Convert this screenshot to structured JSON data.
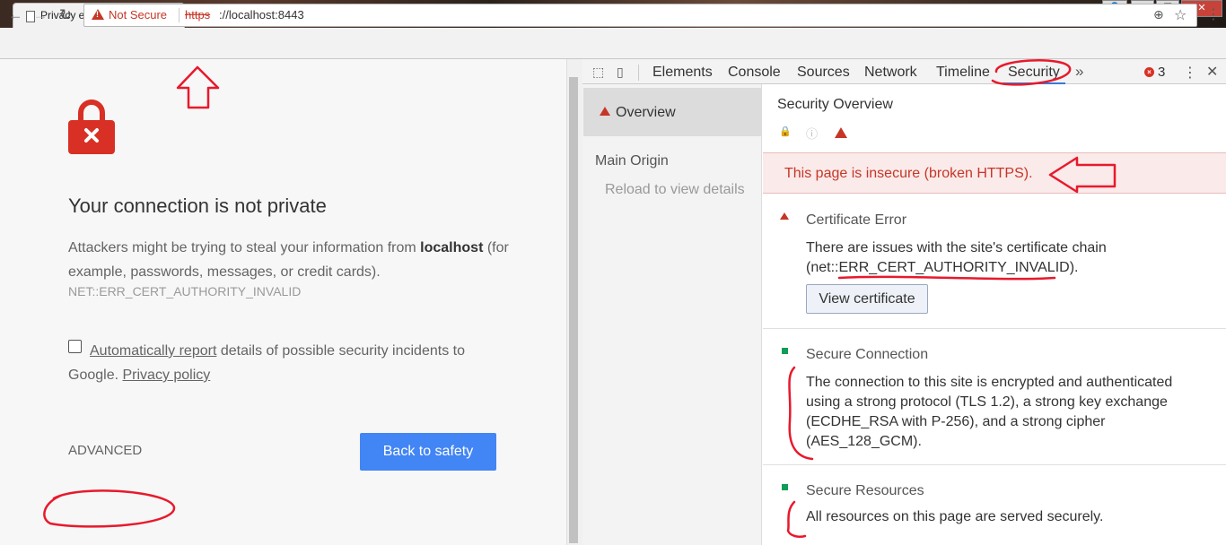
{
  "tab": {
    "title": "Privacy error",
    "close": "×"
  },
  "window": {
    "min": "—",
    "max": "❐",
    "close": "✕",
    "user": "👤"
  },
  "toolbar": {
    "back": "←",
    "forward": "→",
    "reload": "↻",
    "not_secure": "Not Secure",
    "url_scheme": "https",
    "url_rest": "://localhost:8443",
    "zoom_icon": "⊕",
    "star_icon": "☆",
    "menu_icon": "⋮"
  },
  "page": {
    "heading": "Your connection is not private",
    "body_pre": "Attackers might be trying to steal your information from ",
    "body_host": "localhost",
    "body_post": " (for example, passwords, messages, or credit cards).",
    "error_code": "NET::ERR_CERT_AUTHORITY_INVALID",
    "report_link": "Automatically report",
    "report_text": " details of possible security incidents to Google. ",
    "privacy_link": "Privacy policy",
    "advanced": "ADVANCED",
    "back_to_safety": "Back to safety",
    "lock_color": "#d93025"
  },
  "devtools": {
    "tabs": [
      "Elements",
      "Console",
      "Sources",
      "Network",
      "Timeline",
      "Security"
    ],
    "more": "»",
    "error_count": "3",
    "error_x": "×",
    "kebab": "⋮",
    "close": "✕",
    "inspect_icon": "⬚",
    "device_icon": "▯",
    "sidebar": {
      "overview": "Overview",
      "main_origin": "Main Origin",
      "reload_hint": "Reload to view details"
    },
    "security": {
      "title": "Security Overview",
      "lock_icon": "🔒",
      "info_icon": "ⓘ",
      "banner": "This page is insecure (broken HTTPS).",
      "cert_title": "Certificate Error",
      "cert_desc": "There are issues with the site's certificate chain (net::ERR_CERT_AUTHORITY_INVALID).",
      "view_cert": "View certificate",
      "conn_title": "Secure Connection",
      "conn_desc": "The connection to this site is encrypted and authenticated using a strong protocol (TLS 1.2), a strong key exchange (ECDHE_RSA with P-256), and a strong cipher (AES_128_GCM).",
      "res_title": "Secure Resources",
      "res_desc": "All resources on this page are served securely."
    }
  },
  "colors": {
    "accent_red": "#c63626",
    "button_blue": "#4285f4",
    "secure_green": "#0f9d58",
    "annotation_red": "#e8192c"
  }
}
